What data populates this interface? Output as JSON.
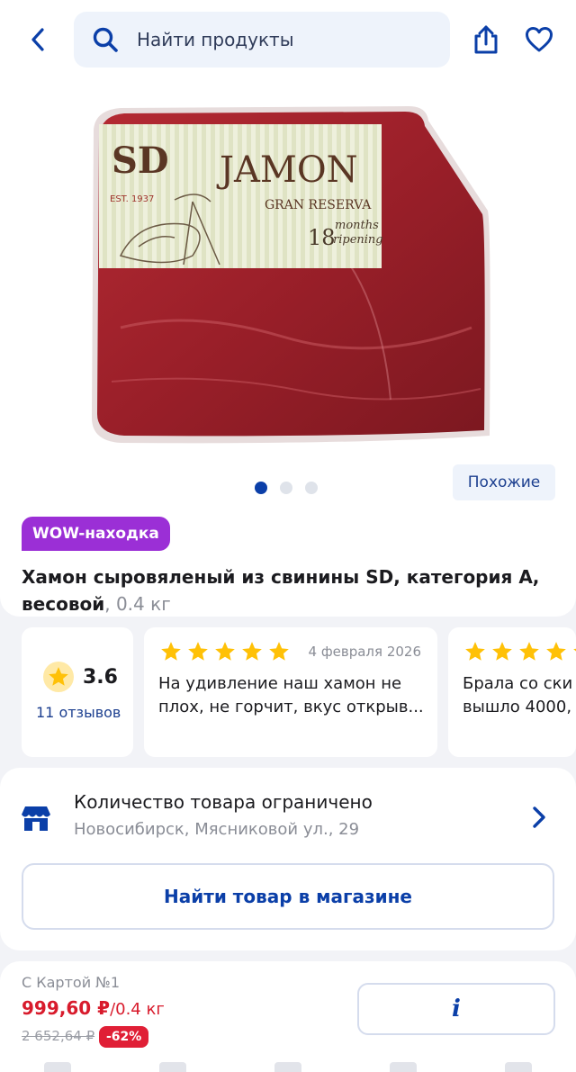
{
  "header": {
    "search_placeholder": "Найти продукты",
    "icons": [
      "back-arrow-icon",
      "search-icon",
      "share-icon",
      "heart-icon"
    ]
  },
  "gallery": {
    "image": {
      "brand": "SD",
      "est": "EST. 1937",
      "name": "JAMON",
      "subtitle": "GRAN RESERVA",
      "months_number": "18",
      "months_text": "months",
      "ripening_text": "ripening"
    },
    "slides_total": 3,
    "active_slide": 0,
    "similar_label": "Похожие"
  },
  "product": {
    "badge": "WOW-находка",
    "title": "Хамон сыровяленый из свинины SD, категория А, весовой",
    "weight": ", 0.4 кг"
  },
  "rating": {
    "value": "3.6",
    "reviews_count": "11 отзывов"
  },
  "reviews": [
    {
      "stars": 5,
      "date": "4 февраля 2026",
      "text": "На удивление  наш хамон не плох, не горчит,  вкус открыв..."
    },
    {
      "stars": 5,
      "date": "",
      "text": "Брала со ски вышло 4000,"
    }
  ],
  "store": {
    "title": "Количество товара ограничено",
    "address": "Новосибирск, Мясниковой ул., 29",
    "find_button": "Найти товар в магазине"
  },
  "price": {
    "card_label": "С Картой №1",
    "current": "999,60 ₽",
    "unit": "/0.4 кг",
    "old": "2 652,64 ₽",
    "discount": "-62%",
    "info_button": "i"
  },
  "colors": {
    "accent": "#0b3fa8",
    "badge_purple": "#9b2fd6",
    "price_red": "#d81b2c",
    "star_yellow": "#ffc107"
  }
}
